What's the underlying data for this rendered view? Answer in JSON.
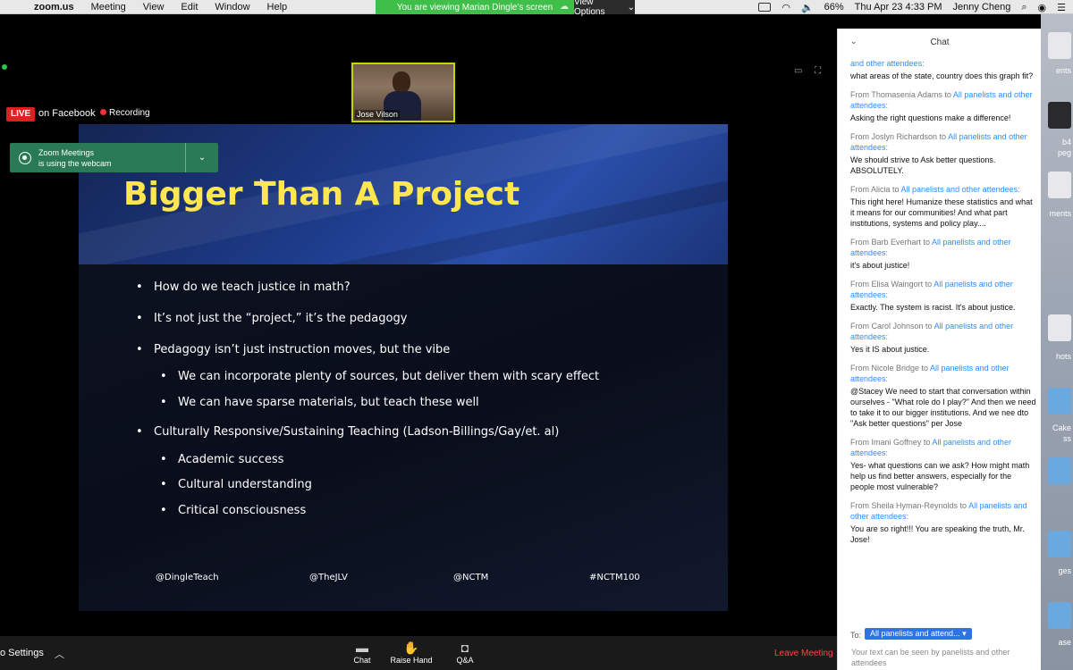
{
  "menubar": {
    "app_name": "zoom.us",
    "items": [
      "Meeting",
      "View",
      "Edit",
      "Window",
      "Help"
    ],
    "share_banner": "You are viewing Marian Dingle's screen",
    "view_options": "View Options",
    "battery": "66%",
    "datetime": "Thu Apr 23  4:33 PM",
    "user": "Jenny Cheng"
  },
  "video": {
    "participant_name": "Jose Vilson"
  },
  "status": {
    "live_label": "LIVE",
    "live_platform": "on Facebook",
    "recording_label": "Recording"
  },
  "webcam_toast": {
    "line1": "Zoom Meetings",
    "line2": "is using the webcam"
  },
  "slide": {
    "title": "Bigger Than A Project",
    "bullets": [
      "How do we teach justice in math?",
      "It’s not just the “project,” it’s the pedagogy",
      "Pedagogy isn’t just instruction moves, but the vibe",
      "We can incorporate plenty of sources, but deliver them with scary effect",
      "We can have sparse materials, but teach these well",
      "Culturally Responsive/Sustaining Teaching (Ladson-Billings/Gay/et. al)",
      "Academic success",
      "Cultural understanding",
      "Critical consciousness"
    ],
    "footer": [
      "@DingleTeach",
      "@TheJLV",
      "@NCTM",
      "#NCTM100"
    ]
  },
  "toolbar": {
    "settings": "o Settings",
    "chat": "Chat",
    "raise_hand": "Raise Hand",
    "qa": "Q&A",
    "leave": "Leave Meeting"
  },
  "chat": {
    "title": "Chat",
    "messages": [
      {
        "from": "",
        "to": "and other attendees",
        "text": "what areas of the state, country does this graph fit?"
      },
      {
        "from": "From Thomasenia Adams to",
        "to": "All panelists and other attendees",
        "text": "Asking the right questions make a difference!"
      },
      {
        "from": "From Joslyn Richardson to",
        "to": "All panelists and other attendees",
        "text": "We should strive to Ask better questions. ABSOLUTELY."
      },
      {
        "from": "From Alicia to",
        "to": "All panelists and other attendees",
        "text": "This right here! Humanize these statistics and what it means for our communities!  And what part institutions, systems and policy play...."
      },
      {
        "from": "From Barb Everhart to",
        "to": "All panelists and other attendees",
        "text": "it's about justice!"
      },
      {
        "from": "From Elisa Waingort to",
        "to": "All panelists and other attendees",
        "text": "Exactly. The system is racist. It's about justice."
      },
      {
        "from": "From Carol Johnson to",
        "to": "All panelists and other attendees",
        "text": "Yes it IS about justice."
      },
      {
        "from": "From Nicole Bridge to",
        "to": "All panelists and other attendees",
        "text": "@Stacey We need to start that conversation within ourselves - \"What role do I play?\"  And then we need to take it to our bigger institutions. And we nee dto \"Ask better questions\" per Jose"
      },
      {
        "from": "From Imani Goffney to",
        "to": "All panelists and other attendees",
        "text": "Yes- what questions can we ask? How might math help us find better answers, especially for the people most vulnerable?"
      },
      {
        "from": "From Sheila Hyman-Reynolds to",
        "to": "All panelists and other attendees",
        "text": "You are so right!!! You are speaking the truth, Mr. Jose!"
      }
    ],
    "to_label": "To:",
    "recipient": "All panelists and attend...",
    "note": "Your text can be seen by panelists and other attendees"
  },
  "desktop": {
    "labels": [
      "ents",
      "b4",
      "peg",
      "ments",
      "hots",
      "Cake",
      "ss",
      "ges",
      "ase"
    ]
  }
}
